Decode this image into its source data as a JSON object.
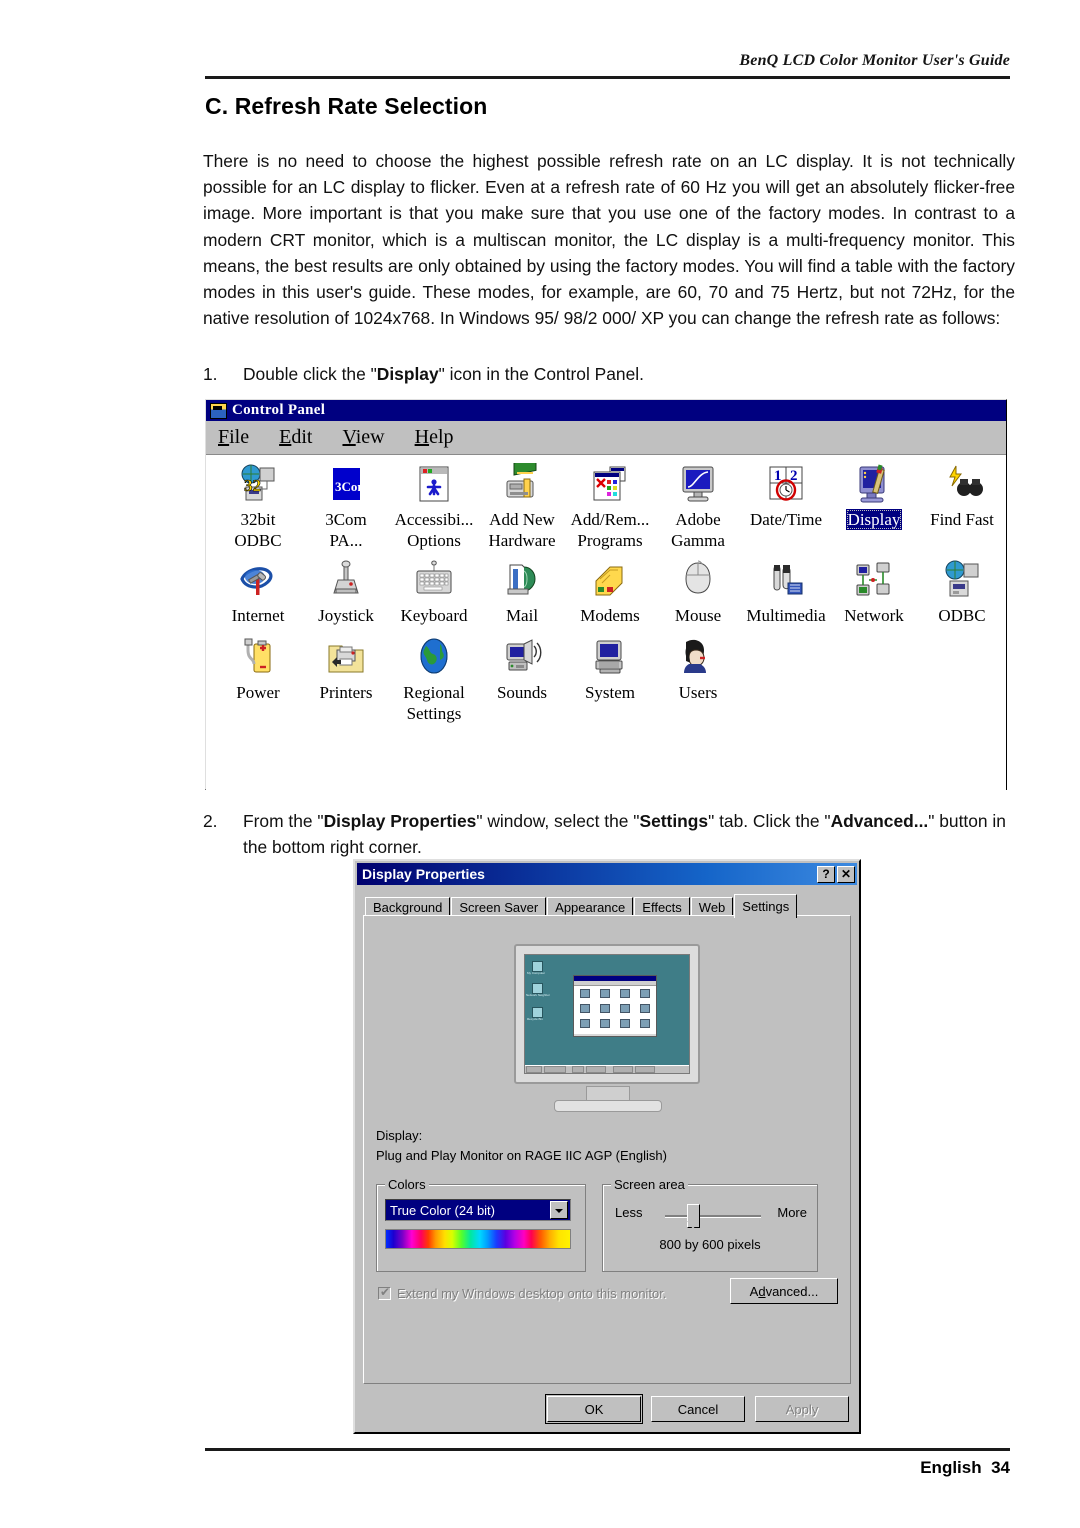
{
  "header": {
    "running_head": "BenQ LCD Color Monitor User's Guide",
    "section_title": "C. Refresh Rate Selection"
  },
  "body": {
    "paragraph": "There is no need to choose the highest possible refresh rate on an LC display. It is not technically possible for an LC display to flicker. Even at a refresh rate of 60 Hz you will get an absolutely flicker-free image. More important is that you make sure that you use one of the factory modes.  In contrast to a modern CRT monitor, which is a multiscan monitor, the LC display is a multi-frequency monitor. This means, the best results are only obtained by using the factory modes. You will find a table with the factory modes in this user's guide. These modes, for example, are 60, 70 and 75 Hertz, but not 72Hz, for the native resolution of 1024x768. In Windows 95/ 98/2 000/ XP you can change the refresh rate as follows:",
    "step1": {
      "number": "1.",
      "pre": "Double click the \"",
      "bold": "Display",
      "post": "\" icon in the Control Panel."
    },
    "step2": {
      "number": "2.",
      "p1": "From the \"",
      "b1": "Display Properties",
      "p2": "\" window, select the \"",
      "b2": "Settings",
      "p3": "\" tab. Click the \"",
      "b3": "Advanced...",
      "p4": "\" button in the bottom right corner."
    }
  },
  "footer": {
    "language": "English",
    "page_number": "34"
  },
  "control_panel": {
    "title": "Control Panel",
    "menu": [
      {
        "label": "File",
        "accel": "F"
      },
      {
        "label": "Edit",
        "accel": "E"
      },
      {
        "label": "View",
        "accel": "V"
      },
      {
        "label": "Help",
        "accel": "H"
      }
    ],
    "icons": [
      {
        "label_line1": "32bit",
        "label_line2": "ODBC",
        "icon": "odbc-32bit-icon",
        "selected": false
      },
      {
        "label_line1": "3Com",
        "label_line2": "PA...",
        "icon": "3com-icon",
        "selected": false
      },
      {
        "label_line1": "Accessibi...",
        "label_line2": "Options",
        "icon": "accessibility-icon",
        "selected": false
      },
      {
        "label_line1": "Add New",
        "label_line2": "Hardware",
        "icon": "add-new-hardware-icon",
        "selected": false
      },
      {
        "label_line1": "Add/Rem...",
        "label_line2": "Programs",
        "icon": "add-remove-programs-icon",
        "selected": false
      },
      {
        "label_line1": "Adobe",
        "label_line2": "Gamma",
        "icon": "adobe-gamma-icon",
        "selected": false
      },
      {
        "label_line1": "Date/Time",
        "label_line2": "",
        "icon": "date-time-icon",
        "selected": false
      },
      {
        "label_line1": "Display",
        "label_line2": "",
        "icon": "display-icon",
        "selected": true
      },
      {
        "label_line1": "Find Fast",
        "label_line2": "",
        "icon": "find-fast-icon",
        "selected": false
      },
      {
        "label_line1": "Internet",
        "label_line2": "",
        "icon": "internet-icon",
        "selected": false
      },
      {
        "label_line1": "Joystick",
        "label_line2": "",
        "icon": "joystick-icon",
        "selected": false
      },
      {
        "label_line1": "Keyboard",
        "label_line2": "",
        "icon": "keyboard-icon",
        "selected": false
      },
      {
        "label_line1": "Mail",
        "label_line2": "",
        "icon": "mail-icon",
        "selected": false
      },
      {
        "label_line1": "Modems",
        "label_line2": "",
        "icon": "modems-icon",
        "selected": false
      },
      {
        "label_line1": "Mouse",
        "label_line2": "",
        "icon": "mouse-icon",
        "selected": false
      },
      {
        "label_line1": "Multimedia",
        "label_line2": "",
        "icon": "multimedia-icon",
        "selected": false
      },
      {
        "label_line1": "Network",
        "label_line2": "",
        "icon": "network-icon",
        "selected": false
      },
      {
        "label_line1": "ODBC",
        "label_line2": "",
        "icon": "odbc-icon",
        "selected": false
      },
      {
        "label_line1": "Power",
        "label_line2": "",
        "icon": "power-icon",
        "selected": false
      },
      {
        "label_line1": "Printers",
        "label_line2": "",
        "icon": "printers-icon",
        "selected": false
      },
      {
        "label_line1": "Regional",
        "label_line2": "Settings",
        "icon": "regional-settings-icon",
        "selected": false
      },
      {
        "label_line1": "Sounds",
        "label_line2": "",
        "icon": "sounds-icon",
        "selected": false
      },
      {
        "label_line1": "System",
        "label_line2": "",
        "icon": "system-icon",
        "selected": false
      },
      {
        "label_line1": "Users",
        "label_line2": "",
        "icon": "users-icon",
        "selected": false
      }
    ]
  },
  "display_properties": {
    "title": "Display Properties",
    "title_buttons": {
      "help": "?",
      "close": "✕"
    },
    "tabs": [
      {
        "label": "Background",
        "active": false
      },
      {
        "label": "Screen Saver",
        "active": false
      },
      {
        "label": "Appearance",
        "active": false
      },
      {
        "label": "Effects",
        "active": false
      },
      {
        "label": "Web",
        "active": false
      },
      {
        "label": "Settings",
        "active": true
      }
    ],
    "display_label": "Display:",
    "display_value": "Plug and Play Monitor on RAGE IIC AGP (English)",
    "colors": {
      "group_title": "Colors",
      "selected": "True Color (24 bit)"
    },
    "screen_area": {
      "group_title": "Screen area",
      "less": "Less",
      "more": "More",
      "value": "800 by 600 pixels"
    },
    "extend_checkbox": {
      "label": "Extend my Windows desktop onto this monitor.",
      "checked": true,
      "enabled": false
    },
    "advanced_button": "Advanced...",
    "buttons": {
      "ok": "OK",
      "cancel": "Cancel",
      "apply": "Apply"
    }
  },
  "colors": {
    "title_bar_blue": "#000080",
    "win_face": "#c0c0c0",
    "selection_blue": "#000080",
    "preview_desktop": "#3f7d87"
  }
}
